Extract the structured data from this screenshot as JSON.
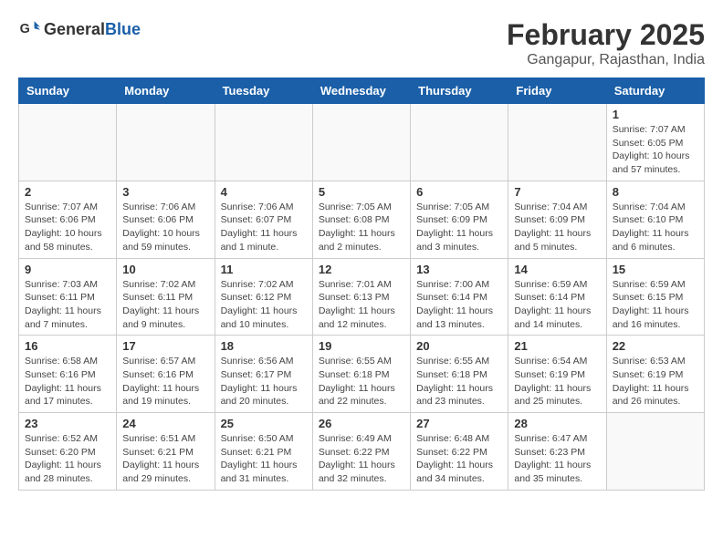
{
  "logo": {
    "general": "General",
    "blue": "Blue"
  },
  "title": "February 2025",
  "subtitle": "Gangapur, Rajasthan, India",
  "days_of_week": [
    "Sunday",
    "Monday",
    "Tuesday",
    "Wednesday",
    "Thursday",
    "Friday",
    "Saturday"
  ],
  "weeks": [
    [
      {
        "day": "",
        "info": ""
      },
      {
        "day": "",
        "info": ""
      },
      {
        "day": "",
        "info": ""
      },
      {
        "day": "",
        "info": ""
      },
      {
        "day": "",
        "info": ""
      },
      {
        "day": "",
        "info": ""
      },
      {
        "day": "1",
        "info": "Sunrise: 7:07 AM\nSunset: 6:05 PM\nDaylight: 10 hours\nand 57 minutes."
      }
    ],
    [
      {
        "day": "2",
        "info": "Sunrise: 7:07 AM\nSunset: 6:06 PM\nDaylight: 10 hours\nand 58 minutes."
      },
      {
        "day": "3",
        "info": "Sunrise: 7:06 AM\nSunset: 6:06 PM\nDaylight: 10 hours\nand 59 minutes."
      },
      {
        "day": "4",
        "info": "Sunrise: 7:06 AM\nSunset: 6:07 PM\nDaylight: 11 hours\nand 1 minute."
      },
      {
        "day": "5",
        "info": "Sunrise: 7:05 AM\nSunset: 6:08 PM\nDaylight: 11 hours\nand 2 minutes."
      },
      {
        "day": "6",
        "info": "Sunrise: 7:05 AM\nSunset: 6:09 PM\nDaylight: 11 hours\nand 3 minutes."
      },
      {
        "day": "7",
        "info": "Sunrise: 7:04 AM\nSunset: 6:09 PM\nDaylight: 11 hours\nand 5 minutes."
      },
      {
        "day": "8",
        "info": "Sunrise: 7:04 AM\nSunset: 6:10 PM\nDaylight: 11 hours\nand 6 minutes."
      }
    ],
    [
      {
        "day": "9",
        "info": "Sunrise: 7:03 AM\nSunset: 6:11 PM\nDaylight: 11 hours\nand 7 minutes."
      },
      {
        "day": "10",
        "info": "Sunrise: 7:02 AM\nSunset: 6:11 PM\nDaylight: 11 hours\nand 9 minutes."
      },
      {
        "day": "11",
        "info": "Sunrise: 7:02 AM\nSunset: 6:12 PM\nDaylight: 11 hours\nand 10 minutes."
      },
      {
        "day": "12",
        "info": "Sunrise: 7:01 AM\nSunset: 6:13 PM\nDaylight: 11 hours\nand 12 minutes."
      },
      {
        "day": "13",
        "info": "Sunrise: 7:00 AM\nSunset: 6:14 PM\nDaylight: 11 hours\nand 13 minutes."
      },
      {
        "day": "14",
        "info": "Sunrise: 6:59 AM\nSunset: 6:14 PM\nDaylight: 11 hours\nand 14 minutes."
      },
      {
        "day": "15",
        "info": "Sunrise: 6:59 AM\nSunset: 6:15 PM\nDaylight: 11 hours\nand 16 minutes."
      }
    ],
    [
      {
        "day": "16",
        "info": "Sunrise: 6:58 AM\nSunset: 6:16 PM\nDaylight: 11 hours\nand 17 minutes."
      },
      {
        "day": "17",
        "info": "Sunrise: 6:57 AM\nSunset: 6:16 PM\nDaylight: 11 hours\nand 19 minutes."
      },
      {
        "day": "18",
        "info": "Sunrise: 6:56 AM\nSunset: 6:17 PM\nDaylight: 11 hours\nand 20 minutes."
      },
      {
        "day": "19",
        "info": "Sunrise: 6:55 AM\nSunset: 6:18 PM\nDaylight: 11 hours\nand 22 minutes."
      },
      {
        "day": "20",
        "info": "Sunrise: 6:55 AM\nSunset: 6:18 PM\nDaylight: 11 hours\nand 23 minutes."
      },
      {
        "day": "21",
        "info": "Sunrise: 6:54 AM\nSunset: 6:19 PM\nDaylight: 11 hours\nand 25 minutes."
      },
      {
        "day": "22",
        "info": "Sunrise: 6:53 AM\nSunset: 6:19 PM\nDaylight: 11 hours\nand 26 minutes."
      }
    ],
    [
      {
        "day": "23",
        "info": "Sunrise: 6:52 AM\nSunset: 6:20 PM\nDaylight: 11 hours\nand 28 minutes."
      },
      {
        "day": "24",
        "info": "Sunrise: 6:51 AM\nSunset: 6:21 PM\nDaylight: 11 hours\nand 29 minutes."
      },
      {
        "day": "25",
        "info": "Sunrise: 6:50 AM\nSunset: 6:21 PM\nDaylight: 11 hours\nand 31 minutes."
      },
      {
        "day": "26",
        "info": "Sunrise: 6:49 AM\nSunset: 6:22 PM\nDaylight: 11 hours\nand 32 minutes."
      },
      {
        "day": "27",
        "info": "Sunrise: 6:48 AM\nSunset: 6:22 PM\nDaylight: 11 hours\nand 34 minutes."
      },
      {
        "day": "28",
        "info": "Sunrise: 6:47 AM\nSunset: 6:23 PM\nDaylight: 11 hours\nand 35 minutes."
      },
      {
        "day": "",
        "info": ""
      }
    ]
  ]
}
